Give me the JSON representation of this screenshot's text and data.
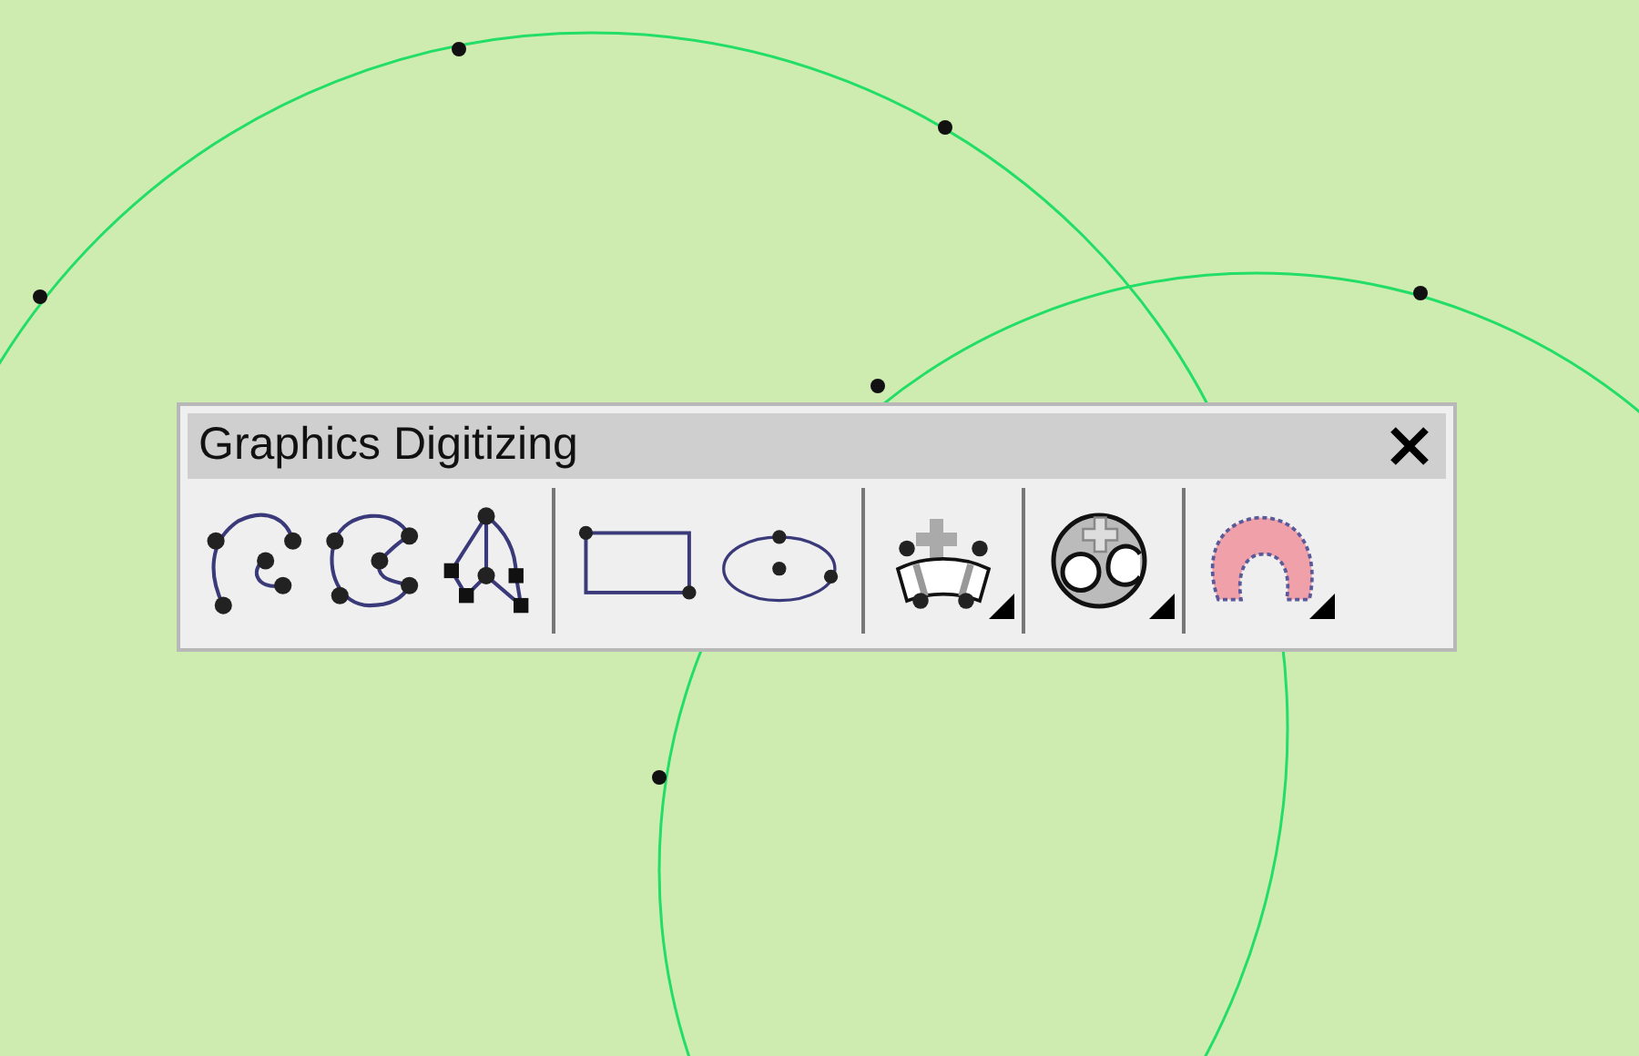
{
  "toolbar": {
    "title": "Graphics Digitizing",
    "tool_groups": [
      {
        "tools": [
          {
            "kind": "arc",
            "has_menu": false
          },
          {
            "kind": "curve",
            "has_menu": false
          },
          {
            "kind": "polyline",
            "has_menu": false
          }
        ]
      },
      {
        "tools": [
          {
            "kind": "rectangle",
            "has_menu": false
          },
          {
            "kind": "ellipse",
            "has_menu": false
          }
        ]
      },
      {
        "tools": [
          {
            "kind": "arc-band",
            "has_menu": true
          }
        ]
      },
      {
        "tools": [
          {
            "kind": "region",
            "has_menu": true
          }
        ]
      },
      {
        "tools": [
          {
            "kind": "blob",
            "has_menu": true
          }
        ]
      }
    ]
  }
}
